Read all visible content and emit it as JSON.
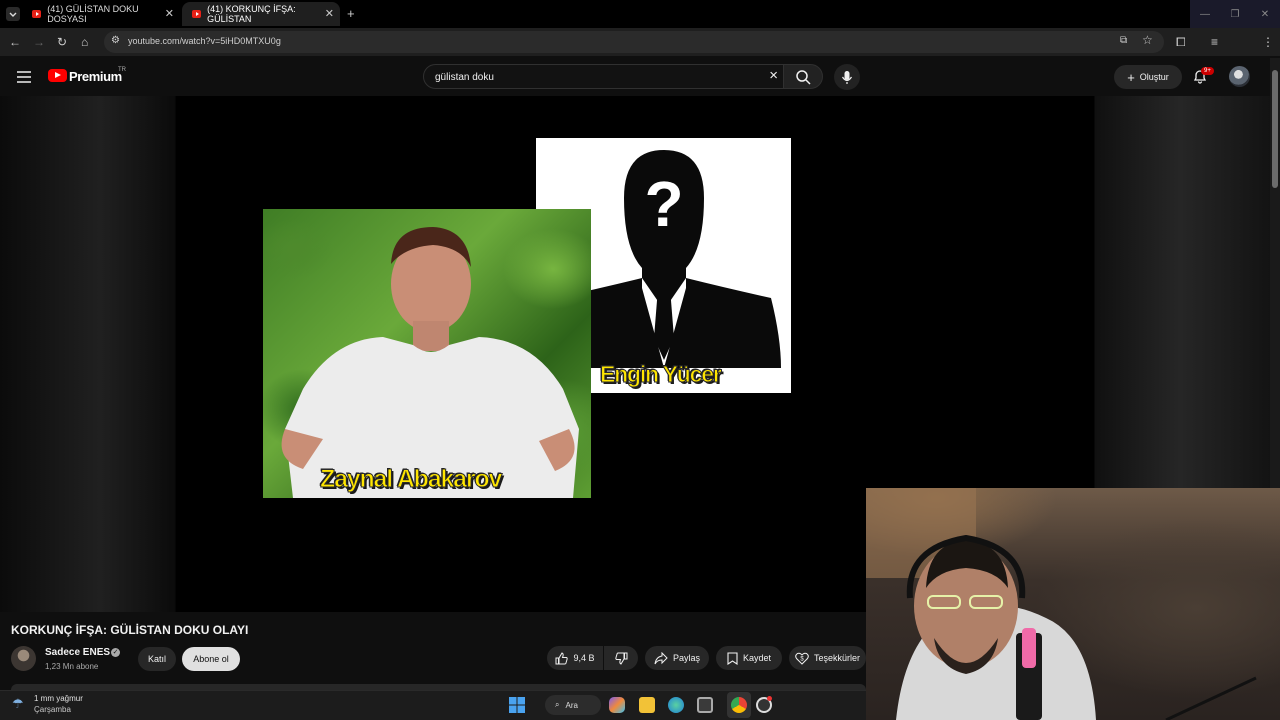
{
  "browser": {
    "tabs": [
      {
        "title": "(41) GÜLİSTAN DOKU DOSYASI"
      },
      {
        "title": "(41) KORKUNÇ İFŞA: GÜLİSTAN"
      }
    ],
    "url": "youtube.com/watch?v=5iHD0MTXU0g",
    "new_tab_label": "+"
  },
  "youtube": {
    "logo_text": "Premium",
    "region": "TR",
    "search_value": "gülistan doku",
    "create_label": "Oluştur",
    "notif_count": "9+"
  },
  "video": {
    "title": "KORKUNÇ İFŞA: GÜLİSTAN DOKU OLAYI",
    "frame_captions": {
      "upper": "Engin Yücer",
      "lower": "Zaynal Abakarov"
    },
    "channel": {
      "name": "Sadece ENES",
      "subscribers": "1,23 Mn abone"
    },
    "join_label": "Katıl",
    "subscribe_label": "Abone ol",
    "like_count": "9,4 B",
    "share_label": "Paylaş",
    "save_label": "Kaydet",
    "thanks_label": "Teşekkürler"
  },
  "taskbar": {
    "weather_temp": "1 mm yağmur",
    "weather_desc": "Çarşamba",
    "search_label": "Ara"
  },
  "colors": {
    "youtube_red": "#ff0000",
    "caption_yellow": "#ffe600",
    "background": "#0f0f0f"
  }
}
